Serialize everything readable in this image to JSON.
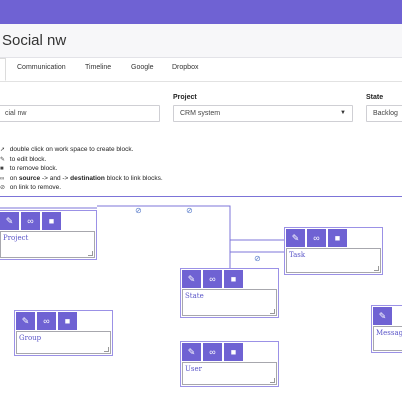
{
  "header": {
    "title": "Social nw"
  },
  "tabs": [
    {
      "label": "Communication"
    },
    {
      "label": "Timeline"
    },
    {
      "label": "Google"
    },
    {
      "label": "Dropbox"
    }
  ],
  "form": {
    "name_value": "cial nw",
    "project_label": "Project",
    "project_value": "CRM system",
    "state_label": "State",
    "state_value": "Backlog"
  },
  "help": {
    "line1_text": " double click on work space to create block.",
    "line2_text": " to edit block.",
    "line3_text": " to remove block.",
    "line4_pre": " on ",
    "line4_source": "source",
    "line4_mid": " -> and -> ",
    "line4_destination": "destination",
    "line4_post": " block to link blocks.",
    "line5_text": " on link to remove."
  },
  "blocks": {
    "project": {
      "label": "Project"
    },
    "task": {
      "label": "Task"
    },
    "state": {
      "label": "State"
    },
    "group": {
      "label": "Group"
    },
    "user": {
      "label": "User"
    },
    "message": {
      "label": "Message"
    }
  },
  "colors": {
    "accent": "#6f62d3",
    "link_line": "#7c74d8",
    "block_label": "#5a55c8"
  },
  "icons": {
    "edit": "edit-icon",
    "link": "link-icon",
    "trash": "trash-icon",
    "unlink": "unlink-icon"
  }
}
